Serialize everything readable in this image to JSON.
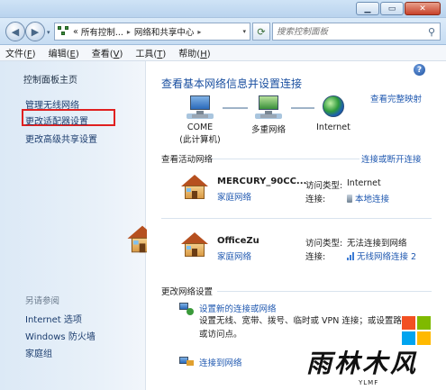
{
  "window": {
    "min_label": "▁",
    "max_label": "▭",
    "close_label": "✕"
  },
  "nav": {
    "back": "◀",
    "forward": "▶",
    "dropdown": "▾"
  },
  "address": {
    "lead": "«",
    "crumbs": [
      "所有控制...",
      "网络和共享中心"
    ],
    "sep": "▸",
    "dropdown": "▾"
  },
  "search": {
    "placeholder": "搜索控制面板",
    "icon": "search-icon"
  },
  "menu": [
    {
      "label": "文件(",
      "key": "F",
      "end": ")"
    },
    {
      "label": "编辑(",
      "key": "E",
      "end": ")"
    },
    {
      "label": "查看(",
      "key": "V",
      "end": ")"
    },
    {
      "label": "工具(",
      "key": "T",
      "end": ")"
    },
    {
      "label": "帮助(",
      "key": "H",
      "end": ")"
    }
  ],
  "sidebar": {
    "home": "控制面板主页",
    "links": [
      "管理无线网络",
      "更改适配器设置",
      "更改高级共享设置"
    ],
    "see_also_title": "另请参阅",
    "see_also": [
      "Internet 选项",
      "Windows 防火墙",
      "家庭组"
    ]
  },
  "main": {
    "help": "?",
    "title": "查看基本网络信息并设置连接",
    "full_map": "查看完整映射",
    "nodes": [
      {
        "label": "COME",
        "sub": "(此计算机)",
        "icon": "computer-icon"
      },
      {
        "label": "多重网络",
        "sub": "",
        "icon": "network-icon"
      },
      {
        "label": "Internet",
        "sub": "",
        "icon": "globe-icon"
      }
    ],
    "active_title": "查看活动网络",
    "connect_link": "连接或断开连接",
    "networks": [
      {
        "name": "MERCURY_90CC...",
        "type": "家庭网络",
        "access_key": "访问类型:",
        "access_val": "Internet",
        "conn_key": "连接:",
        "conn_val": "本地连接",
        "conn_icon": "ethernet-icon"
      },
      {
        "name": "OfficeZu",
        "type": "家庭网络",
        "access_key": "访问类型:",
        "access_val": "无法连接到网络",
        "conn_key": "连接:",
        "conn_val": "无线网络连接 2",
        "conn_icon": "wireless-icon"
      }
    ],
    "change_title": "更改网络设置",
    "tasks": [
      {
        "link": "设置新的连接或网络",
        "desc1": "设置无线、宽带、拨号、临时或 VPN 连接；或设置路",
        "desc2": "或访问点。"
      },
      {
        "link": "连接到网络",
        "desc1": "",
        "desc2": ""
      }
    ]
  },
  "watermark": {
    "text": "雨林木风",
    "sub": "YLMF",
    "colors": [
      "#f25022",
      "#7fba00",
      "#00a4ef",
      "#ffb900"
    ]
  }
}
